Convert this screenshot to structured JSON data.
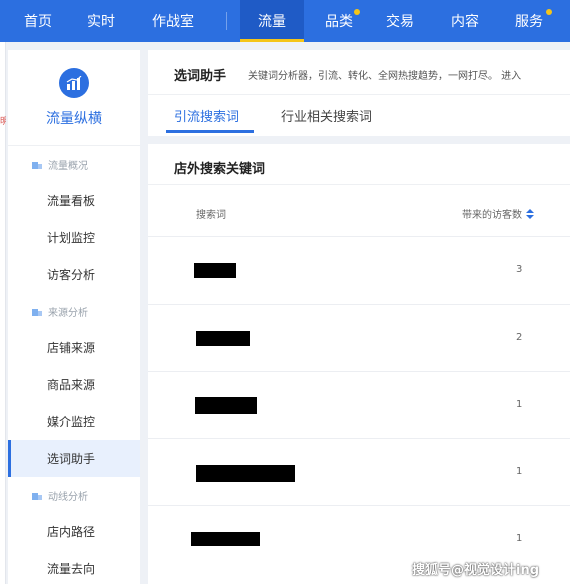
{
  "topnav": {
    "items": [
      {
        "label": "首页"
      },
      {
        "label": "实时"
      },
      {
        "label": "作战室"
      },
      {
        "label": "流量",
        "active": true
      },
      {
        "label": "品类",
        "dot": true
      },
      {
        "label": "交易"
      },
      {
        "label": "内容"
      },
      {
        "label": "服务",
        "dot": true
      }
    ]
  },
  "edge": {
    "mark": "明"
  },
  "sidebar": {
    "brand": "流量纵横",
    "groups": [
      {
        "label": "流量概况",
        "items": [
          "流量看板",
          "计划监控",
          "访客分析"
        ]
      },
      {
        "label": "来源分析",
        "items": [
          "店铺来源",
          "商品来源",
          "媒介监控",
          "选词助手"
        ]
      },
      {
        "label": "动线分析",
        "items": [
          "店内路径",
          "流量去向"
        ]
      }
    ],
    "active_item": "选词助手"
  },
  "header": {
    "title": "选词助手",
    "desc": "关键词分析器，引流、转化、全网热搜趋势，一网打尽。 进入",
    "tabs": [
      "引流搜索词",
      "行业相关搜索词"
    ],
    "active_tab": "引流搜索词"
  },
  "card": {
    "title": "店外搜索关键词",
    "columns": {
      "keyword": "搜索词",
      "visitors": "带来的访客数"
    },
    "rows": [
      {
        "keyword": "",
        "visitors": "3"
      },
      {
        "keyword": "",
        "visitors": "2"
      },
      {
        "keyword": "",
        "visitors": "1"
      },
      {
        "keyword": "",
        "visitors": "1"
      },
      {
        "keyword": "",
        "visitors": "1"
      }
    ]
  },
  "watermark": "搜狐号@视觉设计ing",
  "colors": {
    "primary": "#2c6fe0",
    "accent_dot": "#f5c518"
  }
}
